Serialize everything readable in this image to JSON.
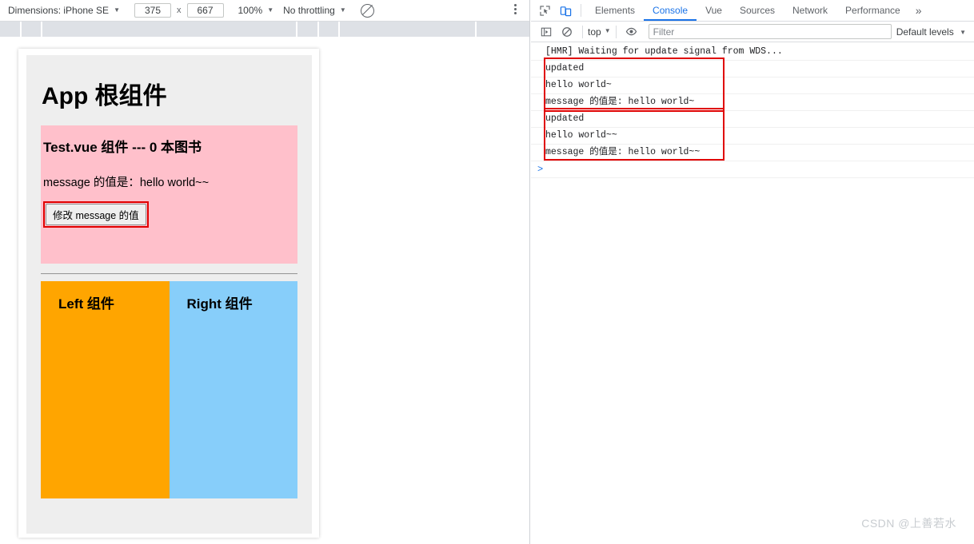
{
  "device_toolbar": {
    "dimensions_label": "Dimensions: iPhone SE",
    "width_value": "375",
    "times_symbol": "x",
    "height_value": "667",
    "zoom_label": "100%",
    "throttling_label": "No throttling",
    "throttle_icon": "no-throttling-icon",
    "more_options_icon": "kebab-menu-icon"
  },
  "viewport": {
    "app_title": "App 根组件",
    "test_component": {
      "heading": "Test.vue 组件 --- 0 本图书",
      "message_line": "message 的值是：hello world~~",
      "button_label": "修改 message 的值"
    },
    "left_component_label": "Left 组件",
    "right_component_label": "Right 组件"
  },
  "devtools": {
    "inspect_icon": "inspect-element-icon",
    "device_toolbar_icon": "toggle-device-toolbar-icon",
    "tabs": [
      {
        "label": "Elements",
        "active": false
      },
      {
        "label": "Console",
        "active": true
      },
      {
        "label": "Vue",
        "active": false
      },
      {
        "label": "Sources",
        "active": false
      },
      {
        "label": "Network",
        "active": false
      },
      {
        "label": "Performance",
        "active": false
      }
    ],
    "overflow_label": "»",
    "console_toolbar": {
      "sidebar_icon": "console-sidebar-icon",
      "clear_icon": "clear-console-icon",
      "context_label": "top",
      "eye_icon": "live-expression-icon",
      "filter_placeholder": "Filter",
      "filter_value": "",
      "levels_label": "Default levels"
    },
    "console_messages": [
      {
        "text": "[HMR] Waiting for update signal from WDS...",
        "boxed": false
      },
      {
        "text": "updated",
        "boxed": true
      },
      {
        "text": "hello world~",
        "boxed": true
      },
      {
        "text": "message 的值是: hello world~",
        "boxed": true
      },
      {
        "text": "updated",
        "boxed": true
      },
      {
        "text": "hello world~~",
        "boxed": true
      },
      {
        "text": "message 的值是: hello world~~",
        "boxed": true
      }
    ],
    "prompt_symbol": ">"
  },
  "watermark": "CSDN @上善若水",
  "colors": {
    "accent_blue": "#1a73e8",
    "highlight_red": "#e00000",
    "pink_panel": "#ffc0cb",
    "orange_panel": "#ffa500",
    "blue_panel": "#87cefa"
  }
}
